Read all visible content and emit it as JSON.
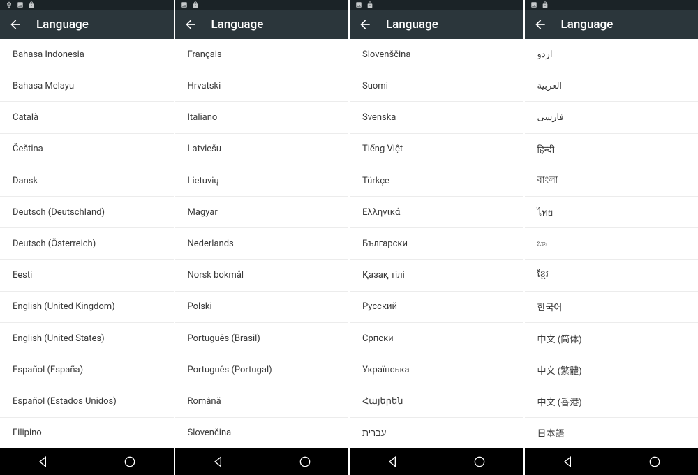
{
  "header_title": "Language",
  "status_icons": {
    "usb": "usb-icon",
    "image": "image-icon",
    "lock": "lock-icon"
  },
  "screens": [
    {
      "status": [
        "usb",
        "image",
        "lock"
      ],
      "items": [
        "Bahasa Indonesia",
        "Bahasa Melayu",
        "Català",
        "Čeština",
        "Dansk",
        "Deutsch (Deutschland)",
        "Deutsch (Österreich)",
        "Eesti",
        "English (United Kingdom)",
        "English (United States)",
        "Español (España)",
        "Español (Estados Unidos)",
        "Filipino"
      ]
    },
    {
      "status": [
        "image",
        "lock"
      ],
      "items": [
        "Français",
        "Hrvatski",
        "Italiano",
        "Latviešu",
        "Lietuvių",
        "Magyar",
        "Nederlands",
        "Norsk bokmål",
        "Polski",
        "Português (Brasil)",
        "Português (Portugal)",
        "Română",
        "Slovenčina"
      ]
    },
    {
      "status": [
        "image",
        "lock"
      ],
      "items": [
        "Slovenščina",
        "Suomi",
        "Svenska",
        "Tiếng Việt",
        "Türkçe",
        "Ελληνικά",
        "Български",
        "Қазақ тілі",
        "Русский",
        "Српски",
        "Українська",
        "Հայերեն",
        "עברית"
      ]
    },
    {
      "status": [
        "image",
        "lock"
      ],
      "items": [
        "اردو",
        "العربية",
        "فارسی",
        "हिन्दी",
        "বাংলা",
        "ไทย",
        "ಬಾ",
        "ខ្មែរ",
        "한국어",
        "中文 (简体)",
        "中文 (繁體)",
        "中文 (香港)",
        "日本語"
      ]
    }
  ]
}
